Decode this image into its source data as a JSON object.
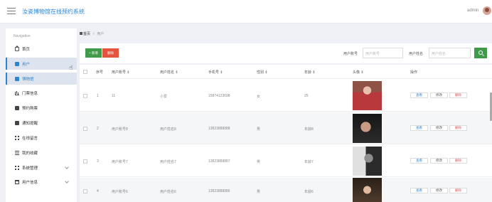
{
  "header": {
    "title": "汝瓷博物馆在线预约系统",
    "user": "admin"
  },
  "sidebar": {
    "heading": "Navigation",
    "items": [
      {
        "label": "首页",
        "icon": "home-icon"
      },
      {
        "label": "用户",
        "icon": "user-icon",
        "active": true
      },
      {
        "label": "博物馆",
        "icon": "museum-icon",
        "active": true
      },
      {
        "label": "门票信息",
        "icon": "chart-icon"
      },
      {
        "label": "预约购票",
        "icon": "ticket-icon"
      },
      {
        "label": "通知提醒",
        "icon": "bell-icon"
      },
      {
        "label": "在线留言",
        "icon": "grid-icon"
      },
      {
        "label": "我的收藏",
        "icon": "list-icon"
      },
      {
        "label": "系统管理",
        "icon": "grid-icon"
      },
      {
        "label": "用户信息",
        "icon": "calendar-icon"
      }
    ]
  },
  "breadcrumb": {
    "home": "首页",
    "separator": "/",
    "current": "用户"
  },
  "toolbar": {
    "add_label": "+ 新增",
    "delete_label": "删除",
    "filter_account_label": "用户账号",
    "filter_account_placeholder": "用户账号",
    "filter_name_label": "用户姓名",
    "filter_name_placeholder": "用户姓名"
  },
  "table": {
    "columns": [
      "序号",
      "用户账号 ⇕",
      "用户姓名 ⇕",
      "手机号 ⇕",
      "性别 ⇕",
      "年龄 ⇕",
      "头像 ⇕",
      "操作"
    ],
    "rows": [
      {
        "index": "1",
        "account": "11",
        "name": "小爱",
        "phone": "15874123698",
        "gender": "女",
        "age": "25"
      },
      {
        "index": "2",
        "account": "用户账号8",
        "name": "用户姓名8",
        "phone": "13823888888",
        "gender": "男",
        "age": "年龄8"
      },
      {
        "index": "3",
        "account": "用户账号7",
        "name": "用户姓名7",
        "phone": "13823888887",
        "gender": "男",
        "age": "年龄7"
      },
      {
        "index": "4",
        "account": "用户账号6",
        "name": "用户姓名6",
        "phone": "13823888886",
        "gender": "男",
        "age": "年龄6"
      }
    ],
    "actions": {
      "view": "查看",
      "edit": "修改",
      "delete": "删除"
    }
  }
}
